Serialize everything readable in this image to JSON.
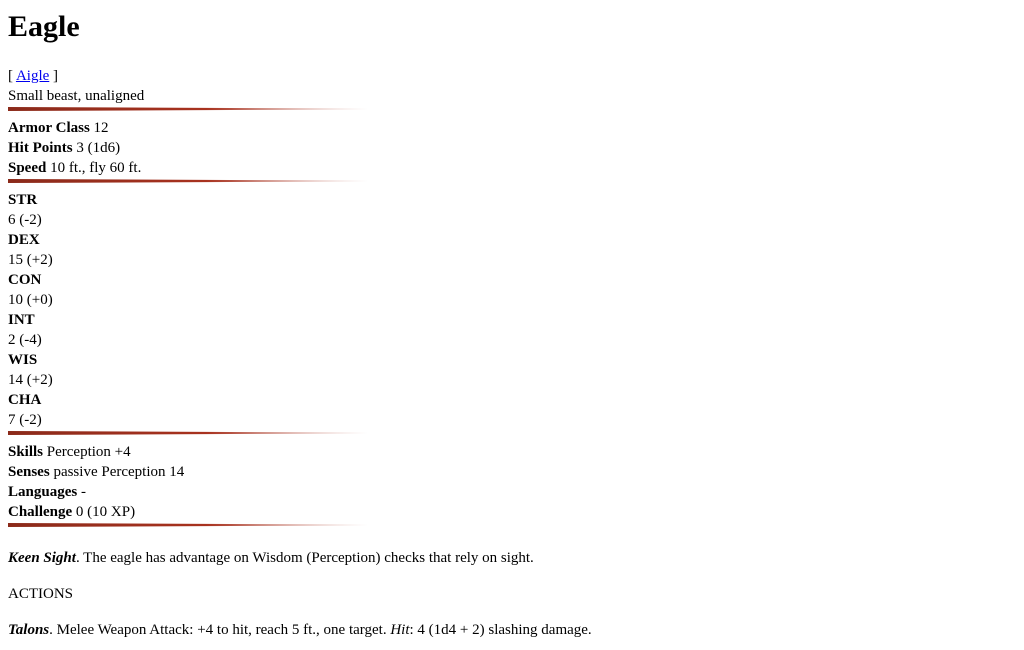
{
  "title": "Eagle",
  "link": {
    "open_bracket": "[",
    "text": "Aigle",
    "close_bracket": "]"
  },
  "subtitle": "Small beast, unaligned",
  "defense": {
    "armor_class_label": "Armor Class",
    "armor_class_value": "12",
    "hit_points_label": "Hit Points",
    "hit_points_value": "3 (1d6)",
    "speed_label": "Speed",
    "speed_value": "10 ft., fly 60 ft."
  },
  "abilities": [
    {
      "name": "STR",
      "value": "6 (-2)"
    },
    {
      "name": "DEX",
      "value": "15 (+2)"
    },
    {
      "name": "CON",
      "value": "10 (+0)"
    },
    {
      "name": "INT",
      "value": "2 (-4)"
    },
    {
      "name": "WIS",
      "value": "14 (+2)"
    },
    {
      "name": "CHA",
      "value": "7 (-2)"
    }
  ],
  "details": {
    "skills_label": "Skills",
    "skills_value": "Perception +4",
    "senses_label": "Senses",
    "senses_value": "passive Perception 14",
    "languages_label": "Languages",
    "languages_value": "-",
    "challenge_label": "Challenge",
    "challenge_value": "0 (10 XP)"
  },
  "traits": {
    "keen_sight_name": "Keen Sight",
    "keen_sight_text": ". The eagle has advantage on Wisdom (Perception) checks that rely on sight."
  },
  "actions_heading": "ACTIONS",
  "actions": {
    "talons_name": "Talons",
    "talons_text": ". Melee Weapon Attack: +4 to hit, reach 5 ft., one target. ",
    "talons_hit_label": "Hit",
    "talons_hit_text": ": 4 (1d4 + 2) slashing damage."
  }
}
